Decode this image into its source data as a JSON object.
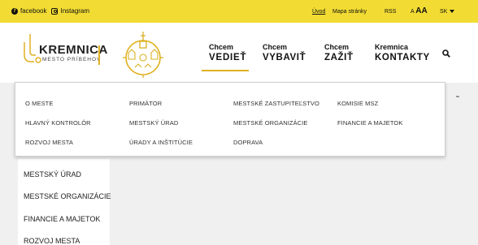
{
  "topbar": {
    "facebook": "facebook",
    "instagram": "Instagram",
    "uvod": "Úvod",
    "mapa": "Mapa stránky",
    "rss": "RSS",
    "font_small": "A",
    "font_big": "AA",
    "lang": "SK"
  },
  "logo": {
    "title": "KREMNICA",
    "subtitle": "MESTO PRÍBEHOV"
  },
  "nav": [
    {
      "line1": "Chcem",
      "line2": "VEDIEŤ"
    },
    {
      "line1": "Chcem",
      "line2": "VYBAVIŤ"
    },
    {
      "line1": "Chcem",
      "line2": "ZAŽIŤ"
    },
    {
      "line1": "Kremnica",
      "line2": "KONTAKTY"
    }
  ],
  "dropdown": {
    "col1": [
      "O MESTE",
      "HLAVNÝ KONTROLÓR",
      "ROZVOJ MESTA"
    ],
    "col2": [
      "PRIMÁTOR",
      "MESTSKÝ ÚRAD",
      "ÚRADY A INŠTITÚCIE"
    ],
    "col3": [
      "MESTSKÉ ZASTUPITEĽSTVO",
      "MESTSKÉ ORGANIZÁCIE",
      "DOPRAVA"
    ],
    "col4": [
      "KOMISIE MSZ",
      "FINANCIE A MAJETOK"
    ]
  },
  "side_menu": [
    "MESTSKÝ ÚRAD",
    "MESTSKÉ ORGANIZÁCIE",
    "FINANCIE A MAJETOK",
    "ROZVOJ MESTA"
  ],
  "colors": {
    "accent": "#f2dc33",
    "underline": "#e0b020"
  }
}
